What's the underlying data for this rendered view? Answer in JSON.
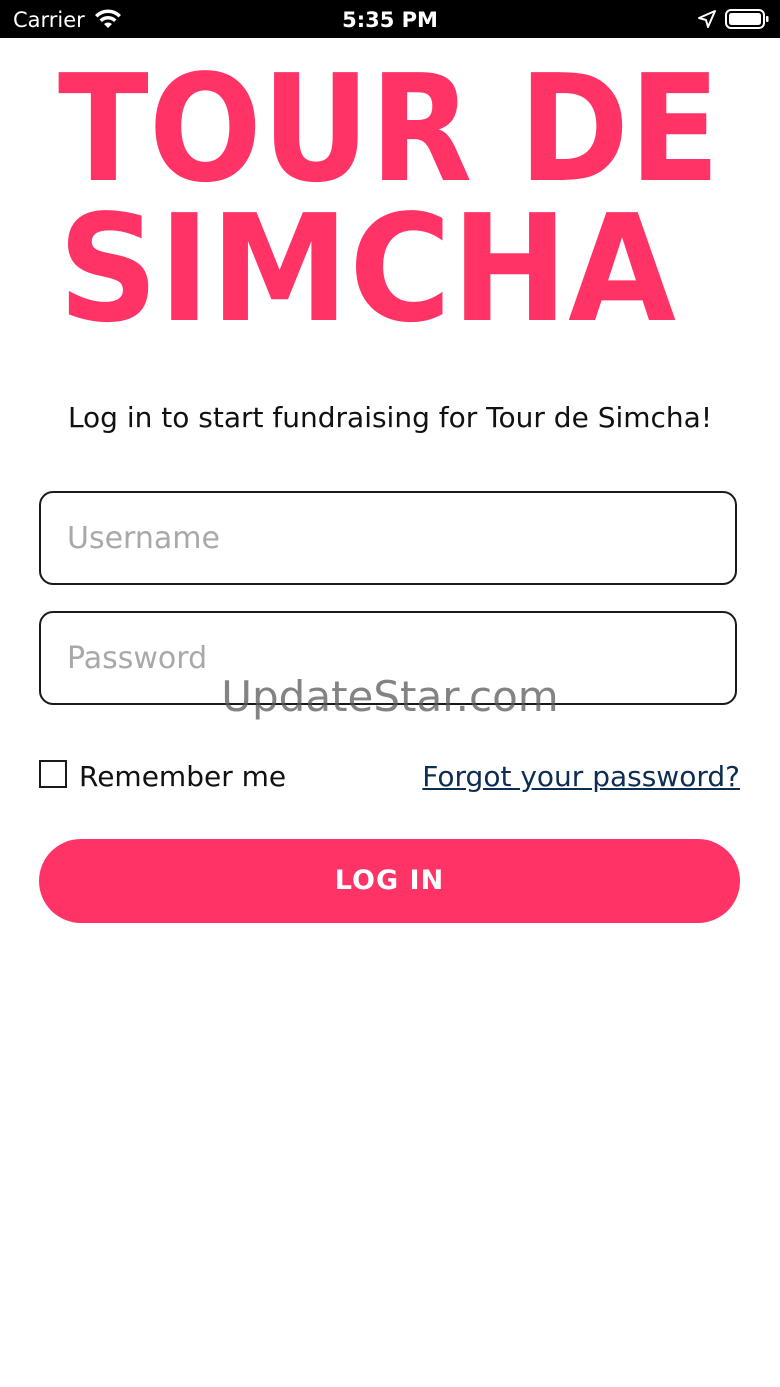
{
  "status_bar": {
    "carrier": "Carrier",
    "time": "5:35 PM",
    "icons": [
      "wifi-icon",
      "location-arrow-icon",
      "battery-icon"
    ]
  },
  "logo": {
    "line1": "TOUR DE",
    "line2": "SIMCHA",
    "color": "#ff3366"
  },
  "tagline": "Log in to start fundraising for Tour de Simcha!",
  "form": {
    "username_placeholder": "Username",
    "password_placeholder": "Password",
    "remember_label": "Remember me",
    "remember_checked": false,
    "forgot_link": "Forgot your password?",
    "login_label": "LOG IN"
  },
  "watermark": "UpdateStar.com",
  "colors": {
    "accent": "#ff3366",
    "link": "#0d2d52"
  }
}
